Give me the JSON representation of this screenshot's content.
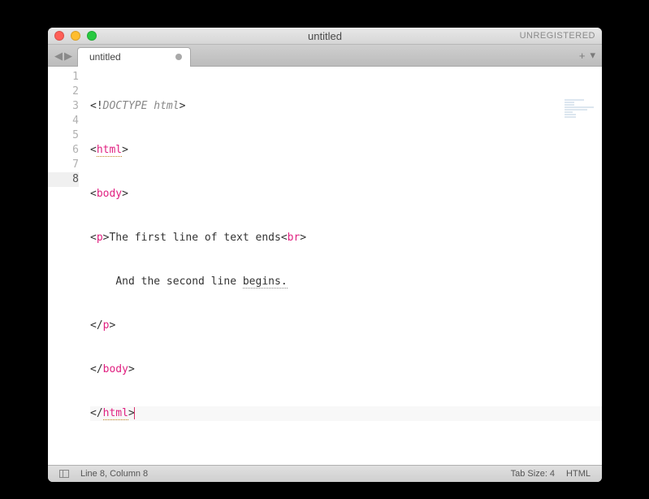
{
  "window": {
    "title": "untitled",
    "registration": "UNREGISTERED"
  },
  "tabs": [
    {
      "label": "untitled",
      "dirty": true
    }
  ],
  "nav": {
    "back": "◀",
    "forward": "▶"
  },
  "tab_actions": {
    "add": "+",
    "menu": "▾"
  },
  "gutter": [
    "1",
    "2",
    "3",
    "4",
    "5",
    "6",
    "7",
    "8"
  ],
  "code": {
    "line1": {
      "open": "<!",
      "doctype": "DOCTYPE html",
      "close": ">"
    },
    "line2": {
      "open": "<",
      "tag": "html",
      "close": ">"
    },
    "line3": {
      "open": "<",
      "tag": "body",
      "close": ">"
    },
    "line4": {
      "open1": "<",
      "tag1": "p",
      "close1": ">",
      "text": "The first line of text ends",
      "open2": "<",
      "tag2": "br",
      "close2": ">"
    },
    "line5": {
      "indent": "    ",
      "text1": "And the second line ",
      "word": "begins.",
      "tail": ""
    },
    "line6": {
      "open": "</",
      "tag": "p",
      "close": ">"
    },
    "line7": {
      "open": "</",
      "tag": "body",
      "close": ">"
    },
    "line8": {
      "open": "</",
      "tag": "html",
      "close": ">"
    }
  },
  "status": {
    "cursor": "Line 8, Column 8",
    "tab_size": "Tab Size: 4",
    "syntax": "HTML"
  }
}
